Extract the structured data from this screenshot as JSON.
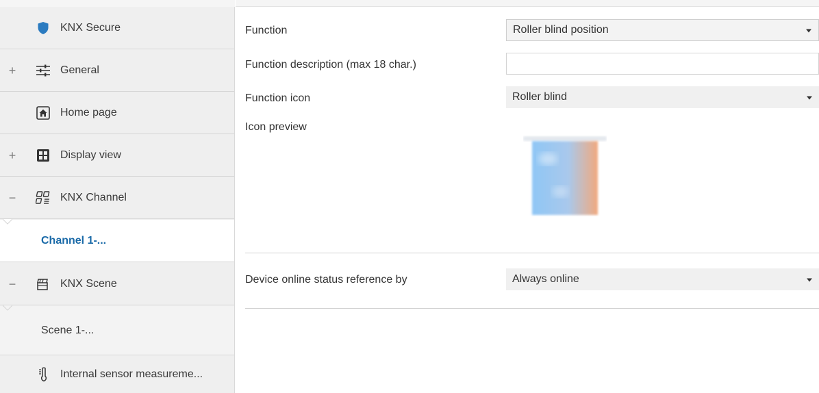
{
  "sidebar": {
    "items": [
      {
        "id": "knx-secure",
        "label": "KNX Secure",
        "icon": "shield-icon",
        "expander": ""
      },
      {
        "id": "general",
        "label": "General",
        "icon": "sliders-icon",
        "expander": "+"
      },
      {
        "id": "home-page",
        "label": "Home page",
        "icon": "home-icon",
        "expander": ""
      },
      {
        "id": "display-view",
        "label": "Display view",
        "icon": "grid-view-icon",
        "expander": "+"
      },
      {
        "id": "knx-channel",
        "label": "KNX Channel",
        "icon": "channel-icon",
        "expander": "−"
      },
      {
        "id": "channel-1",
        "label": "Channel 1-..."
      },
      {
        "id": "knx-scene",
        "label": "KNX Scene",
        "icon": "clapperboard-icon",
        "expander": "−"
      },
      {
        "id": "scene-1",
        "label": "Scene 1-..."
      },
      {
        "id": "internal-sensor",
        "label": "Internal sensor measureme...",
        "icon": "thermometer-icon",
        "expander": ""
      }
    ]
  },
  "main": {
    "function": {
      "label": "Function",
      "value": "Roller blind position"
    },
    "function_description": {
      "label": "Function description (max 18 char.)",
      "value": "",
      "placeholder": ""
    },
    "function_icon": {
      "label": "Function icon",
      "value": "Roller blind"
    },
    "icon_preview": {
      "label": "Icon preview",
      "icon": "roller-blind-icon"
    },
    "device_online": {
      "label": "Device online status reference by",
      "value": "Always online"
    }
  },
  "colors": {
    "accent": "#1a6aa8",
    "shield": "#2b7bc0",
    "sidebar_bg": "#efefef",
    "dropdown_bg": "#f0f0f0"
  }
}
